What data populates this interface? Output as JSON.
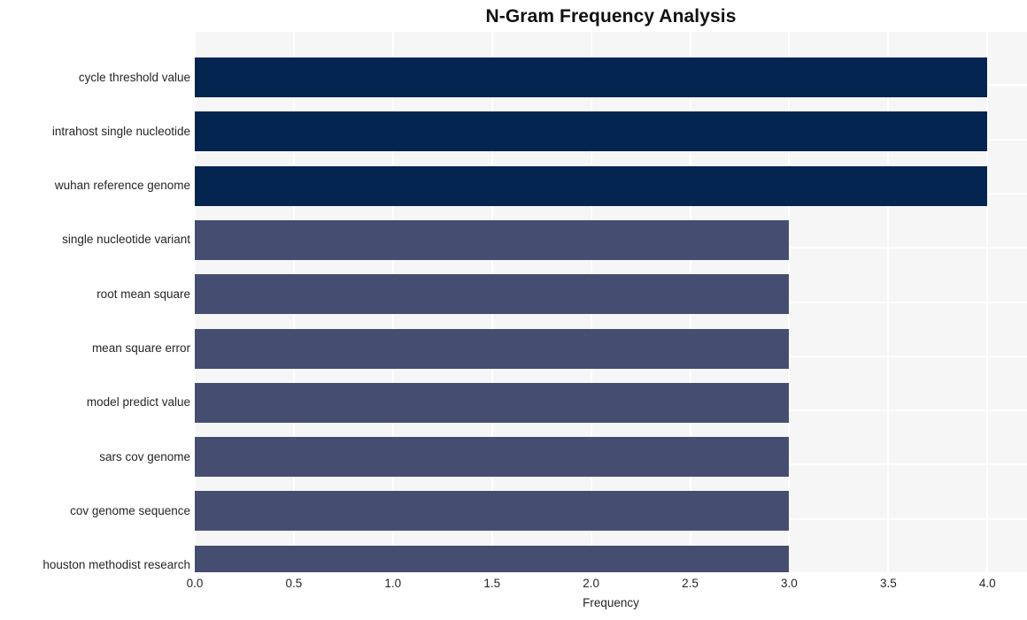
{
  "chart_data": {
    "type": "bar",
    "orientation": "horizontal",
    "title": "N-Gram Frequency Analysis",
    "xlabel": "Frequency",
    "ylabel": "",
    "categories": [
      "cycle threshold value",
      "intrahost single nucleotide",
      "wuhan reference genome",
      "single nucleotide variant",
      "root mean square",
      "mean square error",
      "model predict value",
      "sars cov genome",
      "cov genome sequence",
      "houston methodist research"
    ],
    "values": [
      4,
      4,
      4,
      3,
      3,
      3,
      3,
      3,
      3,
      3
    ],
    "bar_colors": [
      "#042550",
      "#042550",
      "#042550",
      "#454e70",
      "#454e70",
      "#454e70",
      "#454e70",
      "#454e70",
      "#454e70",
      "#454e70"
    ],
    "xlim": [
      0,
      4.2
    ],
    "xticks": [
      0,
      0.5,
      1,
      1.5,
      2,
      2.5,
      3,
      3.5,
      4
    ],
    "xtick_labels": [
      "0.0",
      "0.5",
      "1.0",
      "1.5",
      "2.0",
      "2.5",
      "3.0",
      "3.5",
      "4.0"
    ],
    "grid": true,
    "legend": false,
    "plot_background": "#f6f6f7",
    "grid_color": "#ffffff"
  }
}
